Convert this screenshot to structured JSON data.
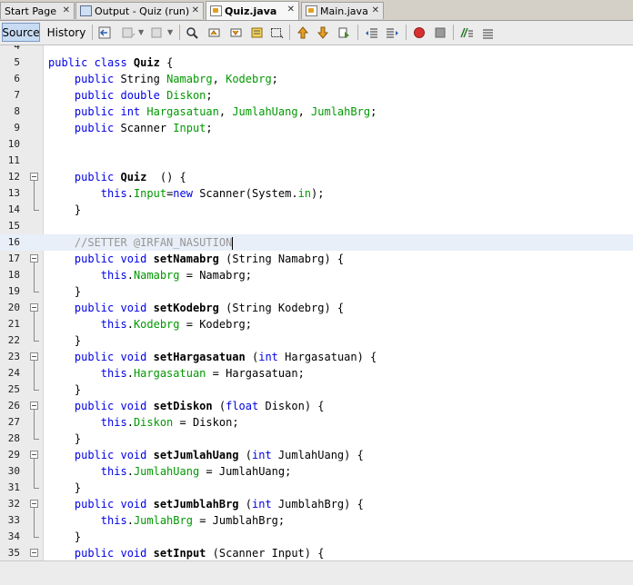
{
  "tabs": [
    {
      "label": "Start Page",
      "icon": "none",
      "active": false
    },
    {
      "label": "Output - Quiz (run)",
      "icon": "output-icon",
      "active": false
    },
    {
      "label": "Quiz.java",
      "icon": "java-file-icon",
      "active": true
    },
    {
      "label": "Main.java",
      "icon": "java-file-icon",
      "active": false
    }
  ],
  "toolbar": {
    "source_label": "Source",
    "history_label": "History"
  },
  "colors": {
    "keyword": "#0000e6",
    "field": "#009900",
    "comment": "#969696",
    "current_line": "#e9eff8"
  },
  "editor": {
    "lines": [
      {
        "n": "4",
        "segs": []
      },
      {
        "n": "5",
        "segs": [
          [
            "kw",
            "public class "
          ],
          [
            "b",
            "Quiz"
          ],
          [
            "",
            "{"
          ]
        ]
      },
      {
        "n": "6",
        "segs": [
          [
            "",
            "    "
          ],
          [
            "kw",
            "public "
          ],
          [
            "",
            "String "
          ],
          [
            "fld",
            "Namabrg"
          ],
          [
            "",
            ", "
          ],
          [
            "fld",
            "Kodebrg"
          ],
          [
            "",
            ";"
          ]
        ]
      },
      {
        "n": "7",
        "segs": [
          [
            "",
            "    "
          ],
          [
            "kw",
            "public double "
          ],
          [
            "fld",
            "Diskon"
          ],
          [
            "",
            ";"
          ]
        ]
      },
      {
        "n": "8",
        "segs": [
          [
            "",
            "    "
          ],
          [
            "kw",
            "public int "
          ],
          [
            "fld",
            "Hargasatuan"
          ],
          [
            "",
            ", "
          ],
          [
            "fld",
            "JumlahUang"
          ],
          [
            "",
            ", "
          ],
          [
            "fld",
            "JumlahBrg"
          ],
          [
            "",
            ";"
          ]
        ]
      },
      {
        "n": "9",
        "segs": [
          [
            "",
            "    "
          ],
          [
            "kw",
            "public "
          ],
          [
            "",
            "Scanner "
          ],
          [
            "fld",
            "Input"
          ],
          [
            "",
            ";"
          ]
        ]
      },
      {
        "n": "10",
        "segs": []
      },
      {
        "n": "11",
        "segs": []
      },
      {
        "n": "12",
        "segs": [
          [
            "",
            "    "
          ],
          [
            "kw",
            "public "
          ],
          [
            "b",
            "Quiz"
          ],
          [
            "",
            " () {"
          ]
        ],
        "fold": "start"
      },
      {
        "n": "13",
        "segs": [
          [
            "",
            "        "
          ],
          [
            "kw",
            "this"
          ],
          [
            "",
            "."
          ],
          [
            "fld",
            "Input"
          ],
          [
            "",
            "="
          ],
          [
            "kw",
            "new "
          ],
          [
            "",
            "Scanner(System."
          ],
          [
            "fld",
            "in"
          ],
          [
            "",
            ");"
          ]
        ]
      },
      {
        "n": "14",
        "segs": [
          [
            "",
            "    }"
          ]
        ],
        "fold": "end"
      },
      {
        "n": "15",
        "segs": []
      },
      {
        "n": "16",
        "segs": [
          [
            "",
            "    "
          ],
          [
            "cmt",
            "//SETTER @IRFAN_NASUTION"
          ]
        ],
        "current": true
      },
      {
        "n": "17",
        "segs": [
          [
            "",
            "    "
          ],
          [
            "kw",
            "public void "
          ],
          [
            "b",
            "setNamabrg"
          ],
          [
            "",
            "(String Namabrg) {"
          ]
        ],
        "fold": "start"
      },
      {
        "n": "18",
        "segs": [
          [
            "",
            "        "
          ],
          [
            "kw",
            "this"
          ],
          [
            "",
            "."
          ],
          [
            "fld",
            "Namabrg"
          ],
          [
            "",
            " = Namabrg;"
          ]
        ]
      },
      {
        "n": "19",
        "segs": [
          [
            "",
            "    }"
          ]
        ],
        "fold": "end"
      },
      {
        "n": "20",
        "segs": [
          [
            "",
            "    "
          ],
          [
            "kw",
            "public void "
          ],
          [
            "b",
            "setKodebrg"
          ],
          [
            "",
            "(String Kodebrg) {"
          ]
        ],
        "fold": "start"
      },
      {
        "n": "21",
        "segs": [
          [
            "",
            "        "
          ],
          [
            "kw",
            "this"
          ],
          [
            "",
            "."
          ],
          [
            "fld",
            "Kodebrg"
          ],
          [
            "",
            " = Kodebrg;"
          ]
        ]
      },
      {
        "n": "22",
        "segs": [
          [
            "",
            "    }"
          ]
        ],
        "fold": "end"
      },
      {
        "n": "23",
        "segs": [
          [
            "",
            "    "
          ],
          [
            "kw",
            "public void "
          ],
          [
            "b",
            "setHargasatuan"
          ],
          [
            "",
            "("
          ],
          [
            "kw",
            "int "
          ],
          [
            "",
            "Hargasatuan) {"
          ]
        ],
        "fold": "start"
      },
      {
        "n": "24",
        "segs": [
          [
            "",
            "        "
          ],
          [
            "kw",
            "this"
          ],
          [
            "",
            "."
          ],
          [
            "fld",
            "Hargasatuan"
          ],
          [
            "",
            " = Hargasatuan;"
          ]
        ]
      },
      {
        "n": "25",
        "segs": [
          [
            "",
            "    }"
          ]
        ],
        "fold": "end"
      },
      {
        "n": "26",
        "segs": [
          [
            "",
            "    "
          ],
          [
            "kw",
            "public void "
          ],
          [
            "b",
            "setDiskon"
          ],
          [
            "",
            "("
          ],
          [
            "kw",
            "float "
          ],
          [
            "",
            "Diskon) {"
          ]
        ],
        "fold": "start"
      },
      {
        "n": "27",
        "segs": [
          [
            "",
            "        "
          ],
          [
            "kw",
            "this"
          ],
          [
            "",
            "."
          ],
          [
            "fld",
            "Diskon"
          ],
          [
            "",
            " = Diskon;"
          ]
        ]
      },
      {
        "n": "28",
        "segs": [
          [
            "",
            "    }"
          ]
        ],
        "fold": "end"
      },
      {
        "n": "29",
        "segs": [
          [
            "",
            "    "
          ],
          [
            "kw",
            "public void "
          ],
          [
            "b",
            "setJumlahUang"
          ],
          [
            "",
            "("
          ],
          [
            "kw",
            "int "
          ],
          [
            "",
            "JumlahUang) {"
          ]
        ],
        "fold": "start"
      },
      {
        "n": "30",
        "segs": [
          [
            "",
            "        "
          ],
          [
            "kw",
            "this"
          ],
          [
            "",
            "."
          ],
          [
            "fld",
            "JumlahUang"
          ],
          [
            "",
            " = JumlahUang;"
          ]
        ]
      },
      {
        "n": "31",
        "segs": [
          [
            "",
            "    }"
          ]
        ],
        "fold": "end"
      },
      {
        "n": "32",
        "segs": [
          [
            "",
            "    "
          ],
          [
            "kw",
            "public void "
          ],
          [
            "b",
            "setJumblahBrg"
          ],
          [
            "",
            "("
          ],
          [
            "kw",
            "int "
          ],
          [
            "",
            "JumblahBrg) {"
          ]
        ],
        "fold": "start"
      },
      {
        "n": "33",
        "segs": [
          [
            "",
            "        "
          ],
          [
            "kw",
            "this"
          ],
          [
            "",
            "."
          ],
          [
            "fld",
            "JumlahBrg"
          ],
          [
            "",
            " = JumblahBrg;"
          ]
        ]
      },
      {
        "n": "34",
        "segs": [
          [
            "",
            "    }"
          ]
        ],
        "fold": "end"
      },
      {
        "n": "35",
        "segs": [
          [
            "",
            "    "
          ],
          [
            "kw",
            "public void "
          ],
          [
            "b",
            "setInput"
          ],
          [
            "",
            "(Scanner Input) {"
          ]
        ],
        "fold": "start"
      }
    ]
  }
}
